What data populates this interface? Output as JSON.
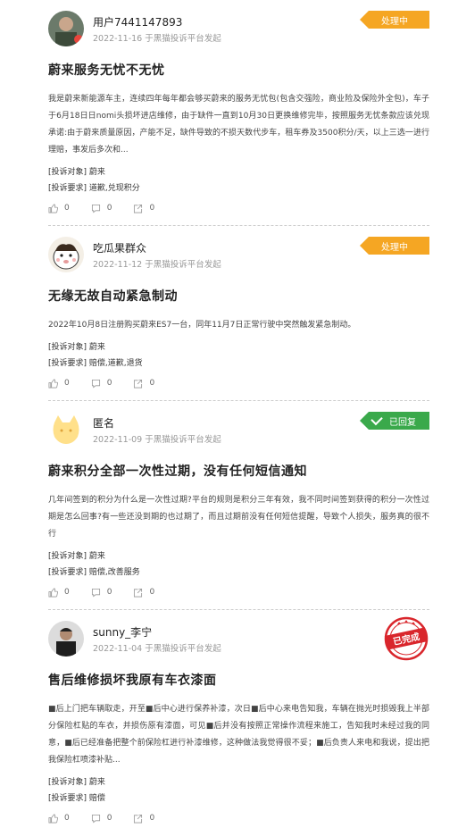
{
  "complaints": [
    {
      "user": "用户7441147893",
      "meta": "2022-11-16 于黑猫投诉平台发起",
      "status": "处理中",
      "title": "蔚来服务无忧不无忧",
      "body": "我是蔚来新能源车主，连续四年每年都会够买蔚来的服务无忧包(包含交强险，商业险及保险外全包)，车子于6月18日日nomi头损坏进店维修，由于缺件一直到10月30日更换维修完毕，按照服务无忧条款应该兑现承诺:由于蔚来质量原因，产能不足，缺件导致的不损天数代步车，租车券及3500积分/天，以上三选一进行理赔，事发后多次和...",
      "target_label": "[投诉对象]",
      "target": "蔚来",
      "demand_label": "[投诉要求]",
      "demand": "道歉,兑现积分",
      "likes": "0",
      "comments": "0",
      "shares": "0"
    },
    {
      "user": "吃瓜果群众",
      "meta": "2022-11-12 于黑猫投诉平台发起",
      "status": "处理中",
      "title": "无缘无故自动紧急制动",
      "body": "2022年10月8日注册购买蔚来ES7一台，同年11月7日正常行驶中突然触发紧急制动。",
      "target_label": "[投诉对象]",
      "target": "蔚来",
      "demand_label": "[投诉要求]",
      "demand": "赔偿,道歉,退货",
      "likes": "0",
      "comments": "0",
      "shares": "0"
    },
    {
      "user": "匿名",
      "meta": "2022-11-09 于黑猫投诉平台发起",
      "status": "已回复",
      "title": "蔚来积分全部一次性过期，没有任何短信通知",
      "body": "几年间签到的积分为什么是一次性过期?平台的规则是积分三年有效，我不同时间签到获得的积分一次性过期是怎么回事?有一些还没到期的也过期了，而且过期前没有任何短信提醒，导致个人损失，服务真的很不行",
      "target_label": "[投诉对象]",
      "target": "蔚来",
      "demand_label": "[投诉要求]",
      "demand": "赔偿,改善服务",
      "likes": "0",
      "comments": "0",
      "shares": "0"
    },
    {
      "user": "sunny_李宁",
      "meta": "2022-11-04 于黑猫投诉平台发起",
      "status": "已完成",
      "title": "售后维修损坏我原有车衣漆面",
      "body": "■后上门把车辆取走，开至■后中心进行保养补漆，次日■后中心来电告知我，车辆在抛光时损毁我上半部分保险杠贴的车衣，并损伤原有漆面，可见■后并没有按照正常操作流程来施工，告知我时未经过我的同意，■后已经准备把整个前保险杠进行补漆维修，这种做法我觉得很不妥；■后负责人来电和我说，提出把我保险杠喷漆补贴...",
      "target_label": "[投诉对象]",
      "target": "蔚来",
      "demand_label": "[投诉要求]",
      "demand": "赔偿",
      "likes": "0",
      "comments": "0",
      "shares": "0"
    }
  ],
  "colors": {
    "processing": "#f5a623",
    "replied": "#3aa94b",
    "done": "#d9262c"
  },
  "icons": {
    "like": "thumbs-up-icon",
    "comment": "comment-icon",
    "share": "share-icon"
  }
}
